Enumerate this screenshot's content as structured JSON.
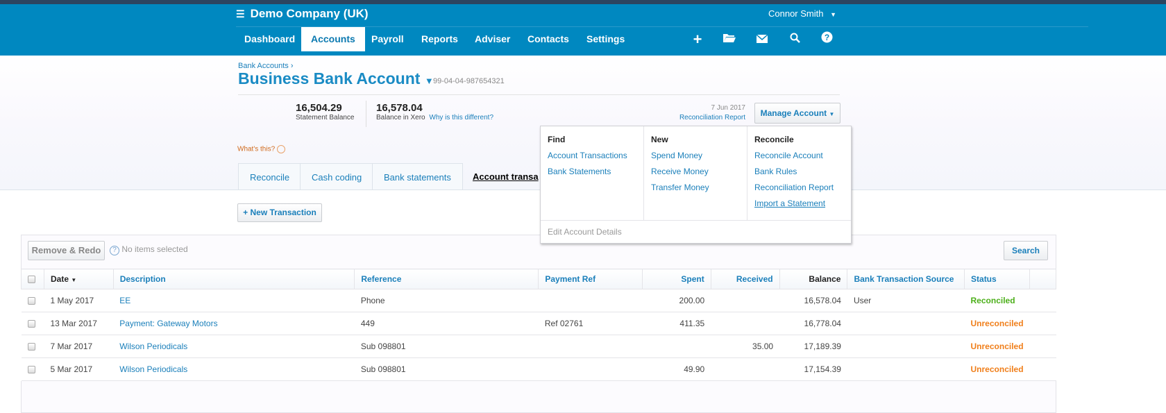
{
  "header": {
    "company": "Demo Company (UK)",
    "user": "Connor Smith",
    "nav": [
      "Dashboard",
      "Accounts",
      "Payroll",
      "Reports",
      "Adviser",
      "Contacts",
      "Settings"
    ],
    "active_nav": "Accounts",
    "icons": [
      "plus-icon",
      "folder-icon",
      "mail-icon",
      "search-icon",
      "help-icon"
    ]
  },
  "page": {
    "breadcrumb": "Bank Accounts ›",
    "title": "Business Bank Account",
    "account_number": "99-04-04-987654321",
    "statement_balance": "16,504.29",
    "statement_balance_label": "Statement Balance",
    "xero_balance": "16,578.04",
    "xero_balance_label": "Balance in Xero",
    "why_link": "Why is this different?",
    "recon_date": "7 Jun 2017",
    "recon_report": "Reconciliation Report",
    "manage_button": "Manage Account",
    "whats_this": "What's this?"
  },
  "tabs": [
    "Reconcile",
    "Cash coding",
    "Bank statements",
    "Account transa"
  ],
  "dropdown": {
    "find": {
      "title": "Find",
      "items": [
        "Account Transactions",
        "Bank Statements"
      ]
    },
    "new": {
      "title": "New",
      "items": [
        "Spend Money",
        "Receive Money",
        "Transfer Money"
      ]
    },
    "reconcile": {
      "title": "Reconcile",
      "items": [
        "Reconcile Account",
        "Bank Rules",
        "Reconciliation Report",
        "Import a Statement"
      ]
    },
    "footer": "Edit Account Details"
  },
  "toolbar": {
    "new_transaction": "+ New Transaction",
    "remove_redo": "Remove & Redo",
    "no_items": "No items selected",
    "search": "Search"
  },
  "table": {
    "headers": [
      "Date",
      "Description",
      "Reference",
      "Payment Ref",
      "Spent",
      "Received",
      "Balance",
      "Bank Transaction Source",
      "Status"
    ],
    "rows": [
      {
        "date": "1 May 2017",
        "description": "EE",
        "reference": "Phone",
        "payment_ref": "",
        "spent": "200.00",
        "received": "",
        "balance": "16,578.04",
        "source": "User",
        "status": "Reconciled"
      },
      {
        "date": "13 Mar 2017",
        "description": "Payment: Gateway Motors",
        "reference": "449",
        "payment_ref": "Ref 02761",
        "spent": "411.35",
        "received": "",
        "balance": "16,778.04",
        "source": "",
        "status": "Unreconciled"
      },
      {
        "date": "7 Mar 2017",
        "description": "Wilson Periodicals",
        "reference": "Sub 098801",
        "payment_ref": "",
        "spent": "",
        "received": "35.00",
        "balance": "17,189.39",
        "source": "",
        "status": "Unreconciled"
      },
      {
        "date": "5 Mar 2017",
        "description": "Wilson Periodicals",
        "reference": "Sub 098801",
        "payment_ref": "",
        "spent": "49.90",
        "received": "",
        "balance": "17,154.39",
        "source": "",
        "status": "Unreconciled"
      }
    ]
  },
  "colors": {
    "header": "#0088c0",
    "reconciled": "#4caf1a",
    "unreconciled": "#f07f1b",
    "link": "#1a7fba"
  }
}
